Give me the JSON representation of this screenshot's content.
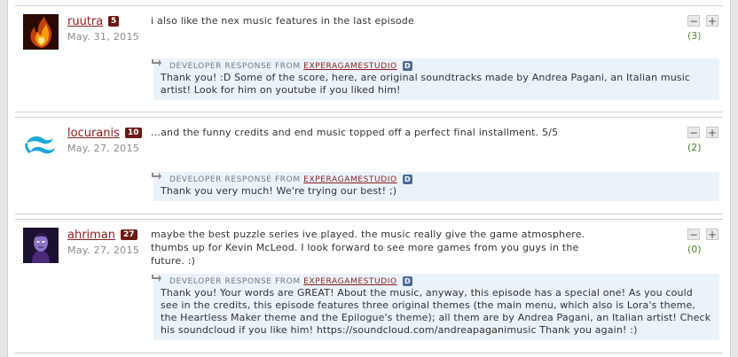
{
  "colors": {
    "username": "#8a1f1b",
    "user_badge": "#6b1a12",
    "score": "#4a8a2a",
    "developer_box": "#eaf2fa",
    "developer_badge": "#4f6c94"
  },
  "reviews": [
    {
      "username": "ruutra",
      "badge": "5",
      "date": "May. 31, 2015",
      "text": "i also like the nex music features in the last episode",
      "vote_down": "−",
      "vote_up": "+",
      "score": "(3)",
      "developer_response": {
        "label": "DEVELOPER RESPONSE FROM",
        "studio": "EXPERAGAMESTUDIO",
        "badge": "D",
        "text": "Thank you! :D Some of the score, here, are original soundtracks made by Andrea Pagani, an Italian music artist! Look for him on youtube if you liked him!"
      }
    },
    {
      "username": "locuranis",
      "badge": "10",
      "date": "May. 27, 2015",
      "text": "...and the funny credits and end music topped off a perfect final installment. 5/5",
      "vote_down": "−",
      "vote_up": "+",
      "score": "(2)",
      "developer_response": {
        "label": "DEVELOPER RESPONSE FROM",
        "studio": "EXPERAGAMESTUDIO",
        "badge": "D",
        "text": "Thank you very much! We're trying our best! ;)"
      }
    },
    {
      "username": "ahriman",
      "badge": "27",
      "date": "May. 27, 2015",
      "text": "maybe the best puzzle series ive played. the music really give the game atmosphere. thumbs up for Kevin McLeod. I look forward to see more games from you guys in the future. :)",
      "vote_down": "−",
      "vote_up": "+",
      "score": "(0)",
      "developer_response": {
        "label": "DEVELOPER RESPONSE FROM",
        "studio": "EXPERAGAMESTUDIO",
        "badge": "D",
        "text": "Thank you! Your words are GREAT! About the music, anyway, this episode has a special one! As you could see in the credits, this episode features three original themes (the main menu, which also is Lora's theme, the Heartless Maker theme and the Epilogue's theme); all them are by Andrea Pagani, an Italian artist! Check his soundcloud if you like him! https://soundcloud.com/andreapaganimusic Thank you again! :)"
      }
    }
  ]
}
